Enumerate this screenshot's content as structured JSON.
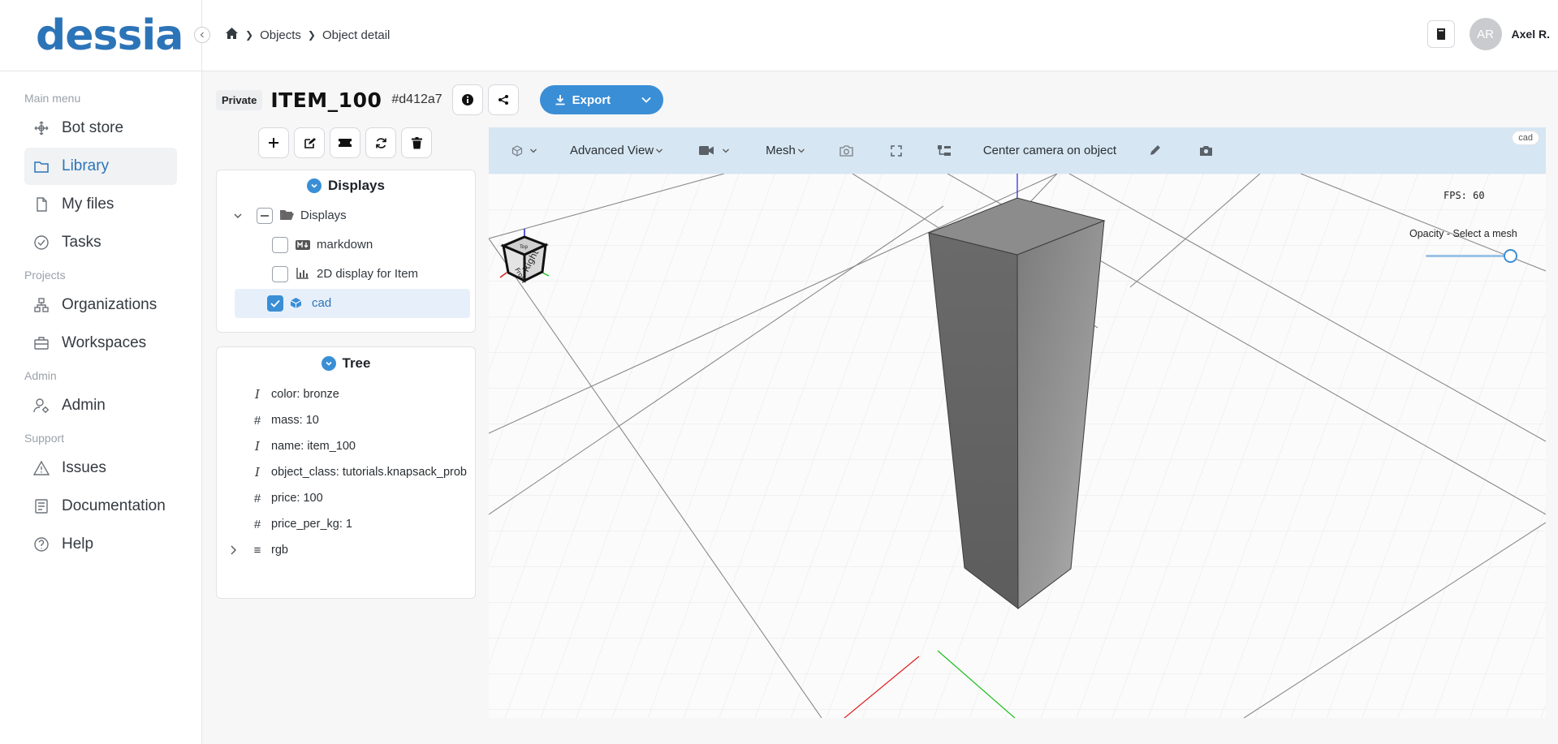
{
  "app": {
    "logo": "dessia"
  },
  "sidebar": {
    "sections": [
      {
        "title": "Main menu",
        "items": [
          {
            "label": "Bot store",
            "icon": "bot-store-icon"
          },
          {
            "label": "Library",
            "icon": "library-icon",
            "active": true
          },
          {
            "label": "My files",
            "icon": "file-icon"
          },
          {
            "label": "Tasks",
            "icon": "check-circle-icon"
          }
        ]
      },
      {
        "title": "Projects",
        "items": [
          {
            "label": "Organizations",
            "icon": "organization-icon"
          },
          {
            "label": "Workspaces",
            "icon": "briefcase-icon"
          }
        ]
      },
      {
        "title": "Admin",
        "items": [
          {
            "label": "Admin",
            "icon": "user-gear-icon"
          }
        ]
      },
      {
        "title": "Support",
        "items": [
          {
            "label": "Issues",
            "icon": "warning-icon"
          },
          {
            "label": "Documentation",
            "icon": "document-icon"
          },
          {
            "label": "Help",
            "icon": "help-icon"
          }
        ]
      }
    ]
  },
  "breadcrumb": {
    "home_icon": "home-icon",
    "items": [
      "Objects",
      "Object detail"
    ]
  },
  "user": {
    "initials": "AR",
    "name": "Axel R."
  },
  "object": {
    "visibility": "Private",
    "name": "ITEM_100",
    "id": "#d412a7"
  },
  "export": {
    "label": "Export"
  },
  "displays": {
    "title": "Displays",
    "root_label": "Displays",
    "items": [
      {
        "label": "markdown",
        "icon": "markdown-icon",
        "checked": false
      },
      {
        "label": "2D display for Item",
        "icon": "chart-icon",
        "checked": false
      },
      {
        "label": "cad",
        "icon": "cube-icon",
        "checked": true
      }
    ]
  },
  "tree": {
    "title": "Tree",
    "rows": [
      {
        "type": "I",
        "text": "color: bronze"
      },
      {
        "type": "#",
        "text": "mass: 10"
      },
      {
        "type": "I",
        "text": "name: item_100"
      },
      {
        "type": "I",
        "text": "object_class: tutorials.knapsack_prob"
      },
      {
        "type": "#",
        "text": "price: 100"
      },
      {
        "type": "#",
        "text": "price_per_kg: 1"
      },
      {
        "type": "≡",
        "text": "rgb"
      }
    ]
  },
  "viewer": {
    "tag": "cad",
    "toolbar": {
      "advanced_view": "Advanced View",
      "mesh": "Mesh",
      "center_camera": "Center camera on object"
    },
    "fps": "FPS: 60",
    "opacity_label": "Opacity - Select a mesh",
    "opacity_value": 1.0,
    "orientation_cube_faces": [
      "Front",
      "Right",
      "Top"
    ],
    "colors": {
      "x_axis": "#e02020",
      "y_axis": "#20c020",
      "z_axis": "#2020e0",
      "accent": "#3a8ed6"
    }
  }
}
